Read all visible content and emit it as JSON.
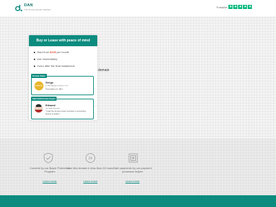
{
  "header": {
    "brand": "DAN",
    "tagline": "The #1 way domain transfers",
    "trustpilot_label": "Trustpilot",
    "star_glyph": "★"
  },
  "offer_card": {
    "title": "Buy or Lease with peace of mind",
    "features": [
      {
        "prefix": "Start from ",
        "price": "$109",
        "suffix": " per month"
      },
      {
        "prefix": "Use immediately",
        "price": "",
        "suffix": ""
      },
      {
        "prefix": "Yours after the final installment",
        "price": "",
        "suffix": ""
      }
    ]
  },
  "agents": [
    {
      "badge": "Domain Seller",
      "name": "Sergo",
      "line": "1,152 Digital Content, LLC",
      "meta": "9 domains on offer",
      "avatar_text": "DIGITAL"
    },
    {
      "badge": "Safe.DAN Domain Expert",
      "name": "Edward",
      "line": "On Safe Domain",
      "meta": "\"I was the human expert involved in connecting buyers & sellers.\""
    }
  ],
  "domain_word": "domain",
  "features_bottom": [
    {
      "text": "Covered by our Buyer Protection Program",
      "link": "Learn more",
      "icon": "shield-icon"
    },
    {
      "text": "Use this domain in less than 24 hours",
      "link": "Learn more",
      "icon": "clock-24-icon"
    },
    {
      "text": "Safe payments by our payment processor Adyen",
      "link": "Learn more",
      "icon": "safe-icon"
    }
  ],
  "colors": {
    "accent": "#0c8b7f",
    "price": "#e04e39",
    "trustpilot": "#00b67a"
  }
}
